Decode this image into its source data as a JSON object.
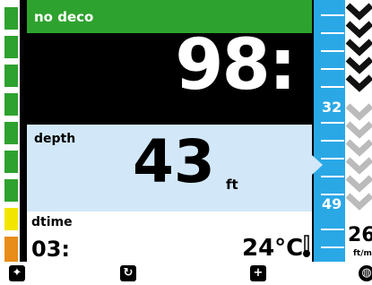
{
  "nodeco": {
    "label": "no deco",
    "value": "98:"
  },
  "depth": {
    "label": "depth",
    "value": "43",
    "unit": "ft"
  },
  "dtime": {
    "label": "dtime",
    "value": "03:"
  },
  "temperature": {
    "value": "24°C"
  },
  "ascent_rate": {
    "value": "26",
    "unit": "ft/mi"
  },
  "depth_scale": {
    "labels": [
      "32",
      "49"
    ]
  },
  "tissue_colors": [
    "#2ea22e",
    "#2ea22e",
    "#2ea22e",
    "#2ea22e",
    "#2ea22e",
    "#2ea22e",
    "#2ea22e",
    "#f2e600",
    "#e88c1a"
  ],
  "buttons": [
    "sparkle-icon",
    "rotate-icon",
    "plus-icon",
    "globe-icon"
  ],
  "colors": {
    "green": "#2ea22e",
    "scale_blue": "#2aa8e6",
    "depth_bg": "#d2e8f8"
  }
}
